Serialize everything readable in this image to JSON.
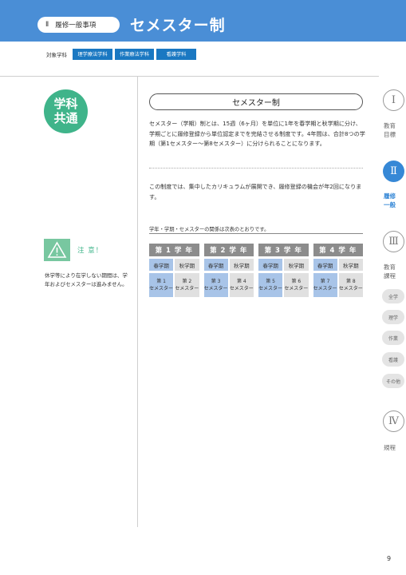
{
  "header": {
    "chapter_num": "Ⅱ",
    "chapter_label": "履修一般事項",
    "title": "セメスター制"
  },
  "target": {
    "label": "対象学科",
    "tags": [
      "理学療法学科",
      "作業療法学科",
      "看護学科"
    ]
  },
  "badge": {
    "line1": "学科",
    "line2": "共通"
  },
  "section_title": "セメスター制",
  "para1": "セメスター（学期）制とは、15週（6ヶ月）を単位に1年を春学期と秋学期に分け、学期ごとに履修登録から単位認定までを完結させる制度です。4年間は、合計8つの学期（第1セメスター〜第8セメスター）に分けられることになります。",
  "para2": "この制度では、集中したカリキュラムが展開でき、履修登録の機会が年2回になります。",
  "table_caption": "学年・学期・セメスターの関係は次表のとおりです。",
  "semester_table": {
    "years": [
      {
        "label": "第 1 学 年",
        "terms": [
          "春学期",
          "秋学期"
        ],
        "sems": [
          [
            "第 1",
            "セメスター"
          ],
          [
            "第 2",
            "セメスター"
          ]
        ]
      },
      {
        "label": "第 2 学 年",
        "terms": [
          "春学期",
          "秋学期"
        ],
        "sems": [
          [
            "第 3",
            "セメスター"
          ],
          [
            "第 4",
            "セメスター"
          ]
        ]
      },
      {
        "label": "第 3 学 年",
        "terms": [
          "春学期",
          "秋学期"
        ],
        "sems": [
          [
            "第 5",
            "セメスター"
          ],
          [
            "第 6",
            "セメスター"
          ]
        ]
      },
      {
        "label": "第 4 学 年",
        "terms": [
          "春学期",
          "秋学期"
        ],
        "sems": [
          [
            "第 7",
            "セメスター"
          ],
          [
            "第 8",
            "セメスター"
          ]
        ]
      }
    ],
    "colors": {
      "year_head": "#8c8c8c",
      "spring": "#a8c4e8",
      "autumn": "#e0e0e0"
    }
  },
  "caution": {
    "label": "注 意！",
    "text": "休学等により在学しない期間は、学年およびセメスターは進みません。"
  },
  "sidebar": {
    "sections": [
      {
        "num": "Ⅰ",
        "label1": "教育",
        "label2": "目標"
      },
      {
        "num": "Ⅱ",
        "label1": "履修",
        "label2": "一般"
      },
      {
        "num": "Ⅲ",
        "label1": "教育",
        "label2": "課程"
      },
      {
        "num": "Ⅳ",
        "label1": "規程",
        "label2": ""
      }
    ],
    "sub_pills": [
      "全学",
      "理学",
      "作業",
      "看護",
      "その他"
    ]
  },
  "page_number": "9",
  "colors": {
    "header_blue": "#4a8ed6",
    "tag_blue": "#1a78c2",
    "green": "#3fb48a",
    "active_blue": "#3688d6"
  }
}
